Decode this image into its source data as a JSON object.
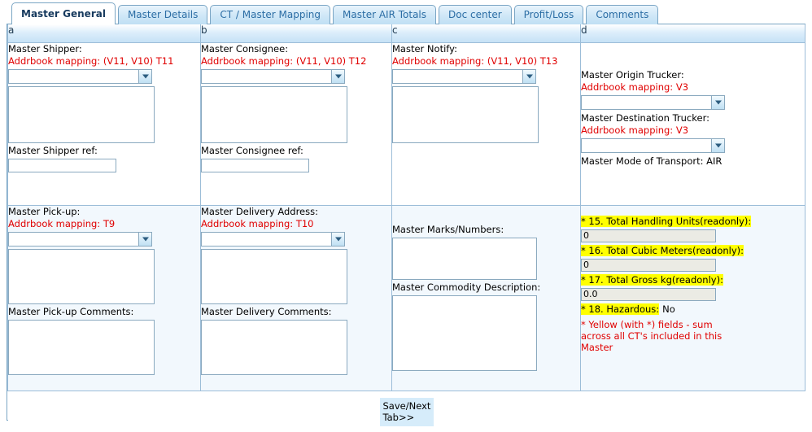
{
  "tabs": [
    {
      "label": "Master General",
      "active": true
    },
    {
      "label": "Master Details",
      "active": false
    },
    {
      "label": "CT / Master Mapping",
      "active": false
    },
    {
      "label": "Master AIR Totals",
      "active": false
    },
    {
      "label": "Doc center",
      "active": false
    },
    {
      "label": "Profit/Loss",
      "active": false
    },
    {
      "label": "Comments",
      "active": false
    }
  ],
  "columns": {
    "a": "a",
    "b": "b",
    "c": "c",
    "d": "d"
  },
  "row1": {
    "shipper": {
      "label": "Master Shipper:",
      "mapping": "Addrbook mapping: (V11, V10) T11",
      "select_value": "",
      "address_value": "",
      "ref_label": "Master Shipper ref:",
      "ref_value": ""
    },
    "consignee": {
      "label": "Master Consignee:",
      "mapping": "Addrbook mapping: (V11, V10) T12",
      "select_value": "",
      "address_value": "",
      "ref_label": "Master Consignee ref:",
      "ref_value": ""
    },
    "notify": {
      "label": "Master Notify:",
      "mapping": "Addrbook mapping: (V11, V10) T13",
      "select_value": "",
      "address_value": ""
    },
    "truckers": {
      "origin_label": "Master Origin Trucker:",
      "origin_mapping": "Addrbook mapping: V3",
      "origin_value": "",
      "destination_label": "Master Destination Trucker:",
      "destination_mapping": "Addrbook mapping: V3",
      "destination_value": "",
      "mode_of_transport": "Master Mode of Transport: AIR"
    }
  },
  "row2": {
    "pickup": {
      "label": "Master Pick-up:",
      "mapping": "Addrbook mapping: T9",
      "select_value": "",
      "address_value": "",
      "comments_label": "Master Pick-up Comments:",
      "comments_value": ""
    },
    "delivery": {
      "label": "Master Delivery Address:",
      "mapping": "Addrbook mapping: T10",
      "select_value": "",
      "address_value": "",
      "comments_label": "Master Delivery Comments:",
      "comments_value": ""
    },
    "marks": {
      "marks_label": "Master Marks/Numbers:",
      "marks_value": "",
      "commodity_label": "Master Commodity Description:",
      "commodity_value": ""
    },
    "totals": {
      "handling_units_label": "* 15. Total Handling Units(readonly):",
      "handling_units_value": "0",
      "cubic_meters_label": "* 16. Total Cubic Meters(readonly):",
      "cubic_meters_value": "0",
      "gross_kg_label": "* 17. Total Gross kg(readonly):",
      "gross_kg_value": "0.0",
      "hazardous_label": "* 18. Hazardous:",
      "hazardous_value": "No",
      "note": "* Yellow (with *) fields - sum across all CT's included in this Master"
    }
  },
  "footer": {
    "save_label": "Save/Next Tab>>"
  },
  "colors": {
    "accent": "#7aa5c4",
    "mapping_red": "#e00000",
    "highlight_yellow": "#ffff00",
    "readonly_gray": "#ebebe4",
    "row2_bg": "#f2f8fd"
  }
}
